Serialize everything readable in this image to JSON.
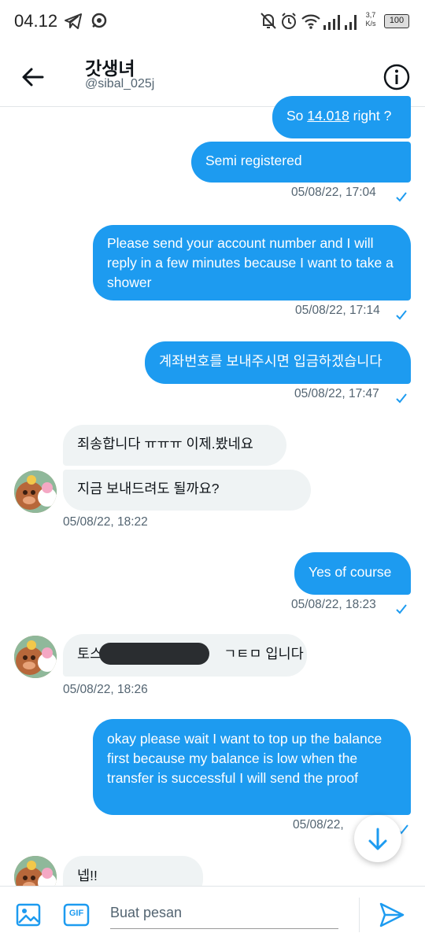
{
  "status_bar": {
    "time": "04.12",
    "net_speed": "3,7",
    "net_unit": "K/s",
    "battery": "100"
  },
  "header": {
    "title": "갓생녀",
    "handle": "@sibal_025j"
  },
  "messages": [
    {
      "dir": "out",
      "text_pre": "So ",
      "link": "14.018",
      "text_post": " right ?"
    },
    {
      "dir": "out",
      "text": "Semi registered",
      "time": "05/08/22, 17:04"
    },
    {
      "dir": "out",
      "text": "Please send your account number and I will reply in a few minutes because I want to take a shower",
      "time": "05/08/22, 17:14"
    },
    {
      "dir": "out",
      "text": "계좌번호를 보내주시면 입금하겠습니다",
      "time": "05/08/22, 17:47"
    },
    {
      "dir": "in",
      "text": "죄송합니다 ㅠㅠㅠ 이제.봤네요"
    },
    {
      "dir": "in",
      "text": "지금 보내드려도 될까요?",
      "time": "05/08/22, 18:22"
    },
    {
      "dir": "out",
      "text": "Yes of course",
      "time": "05/08/22, 18:23"
    },
    {
      "dir": "in",
      "text_pre": "토스",
      "text_post": "ㄱㅌㅁ 입니다",
      "time": "05/08/22, 18:26"
    },
    {
      "dir": "out",
      "text": "okay please wait I want to top up the balance first because my balance is low when the transfer is successful I will send the proof",
      "time": "05/08/22, "
    },
    {
      "dir": "in",
      "text": "넵!!"
    }
  ],
  "composer": {
    "placeholder": "Buat pesan",
    "gif_label": "GIF"
  },
  "colors": {
    "accent": "#1d9bf0",
    "incoming_bg": "#eff3f4",
    "muted": "#536471"
  },
  "icons": [
    "telegram-icon",
    "chat-icon",
    "mute-icon",
    "alarm-icon",
    "wifi-icon",
    "signal-icon",
    "back-arrow-icon",
    "info-icon",
    "check-icon",
    "arrow-down-icon",
    "image-icon",
    "gif-icon",
    "send-icon"
  ]
}
